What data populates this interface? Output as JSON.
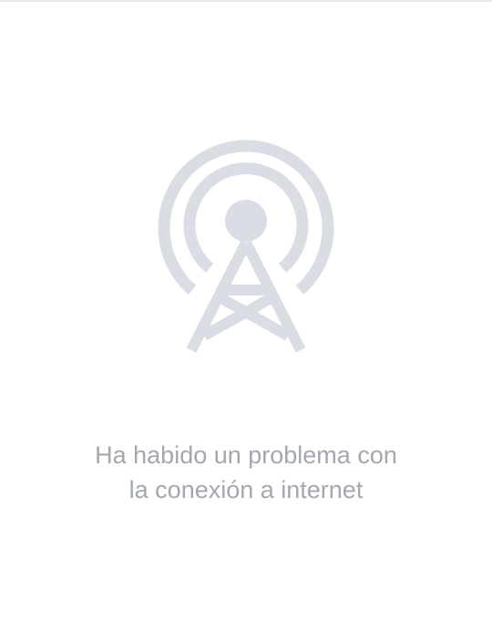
{
  "error_screen": {
    "icon": "broadcast-tower-icon",
    "icon_color": "#dadde4",
    "text_color": "#a3a7ae",
    "message_line1": "Ha habido un problema con",
    "message_line2": "la conexión a internet"
  }
}
